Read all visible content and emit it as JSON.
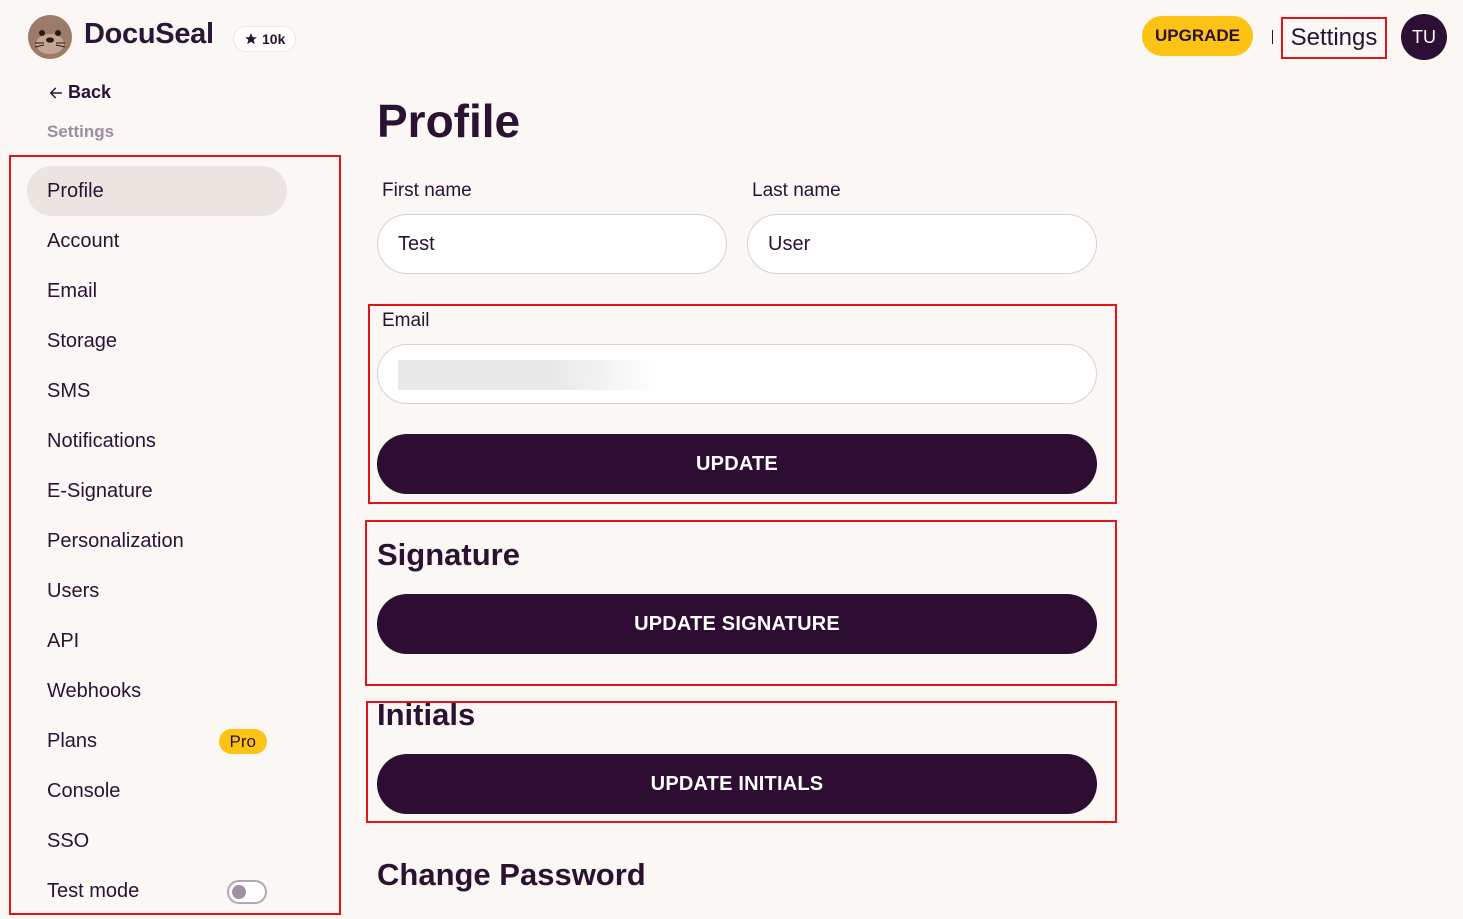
{
  "header": {
    "brand": "DocuSeal",
    "stars": "10k",
    "upgrade_label": "UPGRADE",
    "settings_label": "Settings",
    "avatar_initials": "TU"
  },
  "sidebar": {
    "back_label": "Back",
    "section_title": "Settings",
    "items": [
      {
        "label": "Profile",
        "active": true
      },
      {
        "label": "Account"
      },
      {
        "label": "Email"
      },
      {
        "label": "Storage"
      },
      {
        "label": "SMS"
      },
      {
        "label": "Notifications"
      },
      {
        "label": "E-Signature"
      },
      {
        "label": "Personalization"
      },
      {
        "label": "Users"
      },
      {
        "label": "API"
      },
      {
        "label": "Webhooks"
      },
      {
        "label": "Plans",
        "badge": "Pro"
      },
      {
        "label": "Console"
      },
      {
        "label": "SSO"
      },
      {
        "label": "Test mode",
        "toggle": false
      }
    ]
  },
  "main": {
    "title": "Profile",
    "first_name": {
      "label": "First name",
      "value": "Test"
    },
    "last_name": {
      "label": "Last name",
      "value": "User"
    },
    "email": {
      "label": "Email",
      "value": ""
    },
    "update_label": "UPDATE",
    "signature": {
      "heading": "Signature",
      "button": "UPDATE SIGNATURE"
    },
    "initials": {
      "heading": "Initials",
      "button": "UPDATE INITIALS"
    },
    "change_password": {
      "heading": "Change Password"
    }
  },
  "colors": {
    "background": "#faf7f5",
    "primary": "#2e0d33",
    "accent": "#fcc315",
    "highlight_outline": "#e1141c"
  }
}
